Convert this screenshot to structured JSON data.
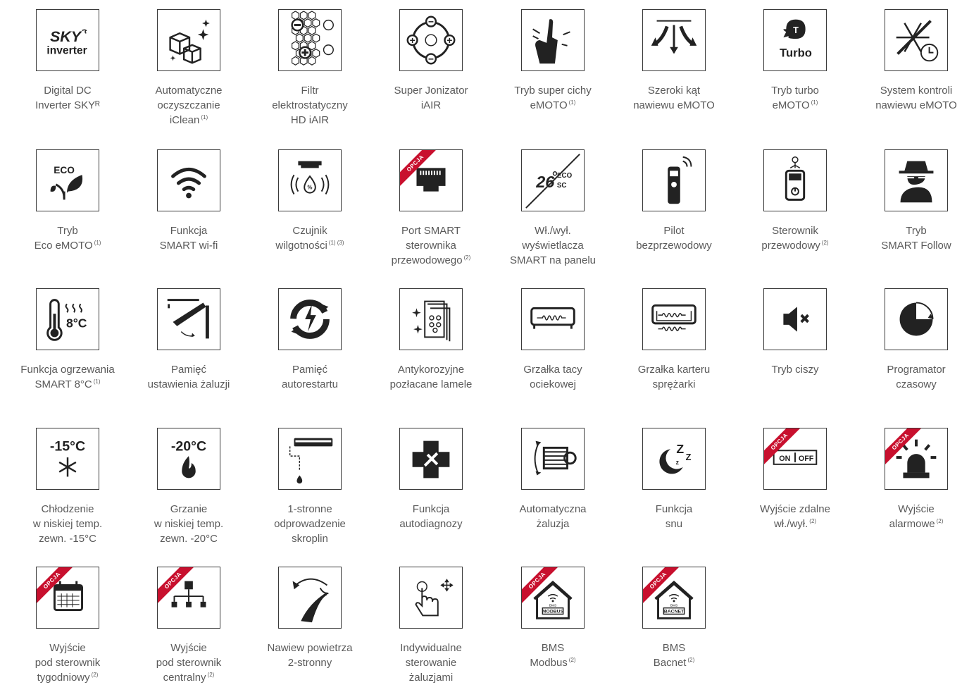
{
  "colors": {
    "border": "#3a3a3a",
    "icon": "#222222",
    "text": "#5a5a5a",
    "ribbon": "#c8102e"
  },
  "ribbon_label": "OPCJA",
  "features": [
    {
      "name": "feature-digital-inverter",
      "icon": "sky-inverter-logo",
      "iconText": [
        "SKY",
        "inverter"
      ],
      "lines": [
        "Digital DC",
        "Inverter SKYᴿ"
      ],
      "sup": ""
    },
    {
      "name": "feature-iclean",
      "icon": "cubes-sparkle-icon",
      "lines": [
        "Automatyczne",
        "oczyszczanie",
        "iClean"
      ],
      "sup": "(1)"
    },
    {
      "name": "feature-hd-iair",
      "icon": "filter-hex-icon",
      "lines": [
        "Filtr",
        "elektrostatyczny",
        "HD iAIR"
      ],
      "sup": ""
    },
    {
      "name": "feature-super-ionizer",
      "icon": "ionizer-icon",
      "lines": [
        "Super Jonizator",
        "iAIR"
      ],
      "sup": ""
    },
    {
      "name": "feature-quiet-mode",
      "icon": "silence-hand-icon",
      "lines": [
        "Tryb super cichy",
        "eMOTO"
      ],
      "sup": "(1)"
    },
    {
      "name": "feature-wide-angle",
      "icon": "wide-airflow-icon",
      "lines": [
        "Szeroki kąt",
        "nawiewu eMOTO"
      ],
      "sup": ""
    },
    {
      "name": "feature-turbo",
      "icon": "turbo-icon",
      "iconText": [
        "T",
        "Turbo"
      ],
      "lines": [
        "Tryb turbo",
        "eMOTO"
      ],
      "sup": "(1)"
    },
    {
      "name": "feature-airflow-control",
      "icon": "snowflake-clock-icon",
      "lines": [
        "System kontroli",
        "nawiewu eMOTO"
      ],
      "sup": ""
    },
    {
      "name": "feature-eco",
      "icon": "eco-leaf-icon",
      "iconText": [
        "ECO"
      ],
      "lines": [
        "Tryb",
        "Eco eMOTO"
      ],
      "sup": "(1)"
    },
    {
      "name": "feature-wifi",
      "icon": "wifi-icon",
      "lines": [
        "Funkcja",
        "SMART wi-fi"
      ],
      "sup": ""
    },
    {
      "name": "feature-humidity",
      "icon": "humidity-sensor-icon",
      "iconText": [
        "%"
      ],
      "lines": [
        "Czujnik",
        "wilgotności"
      ],
      "sup": "(1) (3)"
    },
    {
      "name": "feature-smart-port",
      "icon": "ethernet-port-icon",
      "option": true,
      "lines": [
        "Port SMART",
        "sterownika",
        "przewodowego"
      ],
      "sup": "(2)"
    },
    {
      "name": "feature-display-toggle",
      "icon": "display-off-icon",
      "iconText": [
        "26",
        "ECO",
        "SC"
      ],
      "lines": [
        "Wł./wył.",
        "wyświetlacza",
        "SMART na panelu"
      ],
      "sup": ""
    },
    {
      "name": "feature-remote",
      "icon": "remote-control-icon",
      "lines": [
        "Pilot",
        "bezprzewodowy"
      ],
      "sup": ""
    },
    {
      "name": "feature-wired-controller",
      "icon": "wired-controller-icon",
      "lines": [
        "Sterownik",
        "przewodowy"
      ],
      "sup": "(2)"
    },
    {
      "name": "feature-follow",
      "icon": "spy-icon",
      "lines": [
        "Tryb",
        "SMART Follow"
      ],
      "sup": ""
    },
    {
      "name": "feature-heating-8c",
      "icon": "thermometer-icon",
      "iconText": [
        "8°C"
      ],
      "lines": [
        "Funkcja ogrzewania",
        "SMART 8°C"
      ],
      "sup": "(1)"
    },
    {
      "name": "feature-louver-memory",
      "icon": "louver-memory-icon",
      "lines": [
        "Pamięć",
        "ustawienia żaluzji"
      ],
      "sup": ""
    },
    {
      "name": "feature-autorestart",
      "icon": "restart-icon",
      "lines": [
        "Pamięć",
        "autorestartu"
      ],
      "sup": ""
    },
    {
      "name": "feature-gold-fins",
      "icon": "gold-fins-icon",
      "lines": [
        "Antykorozyjne",
        "pozłacane lamele"
      ],
      "sup": ""
    },
    {
      "name": "feature-tray-heater",
      "icon": "tray-heater-icon",
      "lines": [
        "Grzałka tacy",
        "ociekowej"
      ],
      "sup": ""
    },
    {
      "name": "feature-crankcase-heater",
      "icon": "crankcase-heater-icon",
      "lines": [
        "Grzałka karteru",
        "sprężarki"
      ],
      "sup": ""
    },
    {
      "name": "feature-silent",
      "icon": "mute-icon",
      "lines": [
        "Tryb ciszy"
      ],
      "sup": ""
    },
    {
      "name": "feature-timer",
      "icon": "timer-icon",
      "lines": [
        "Programator",
        "czasowy"
      ],
      "sup": ""
    },
    {
      "name": "feature-cooling-low",
      "icon": "cooling-low-icon",
      "iconText": [
        "-15°C"
      ],
      "lines": [
        "Chłodzenie",
        "w niskiej temp.",
        "zewn. -15°C"
      ],
      "sup": ""
    },
    {
      "name": "feature-heating-low",
      "icon": "heating-low-icon",
      "iconText": [
        "-20°C"
      ],
      "lines": [
        "Grzanie",
        "w niskiej temp.",
        "zewn. -20°C"
      ],
      "sup": ""
    },
    {
      "name": "feature-condensate",
      "icon": "condensate-icon",
      "lines": [
        "1-stronne",
        "odprowadzenie",
        "skroplin"
      ],
      "sup": ""
    },
    {
      "name": "feature-diagnostics",
      "icon": "diagnostics-icon",
      "lines": [
        "Funkcja",
        "autodiagnozy"
      ],
      "sup": ""
    },
    {
      "name": "feature-auto-louver",
      "icon": "auto-louver-icon",
      "lines": [
        "Automatyczna",
        "żaluzja"
      ],
      "sup": ""
    },
    {
      "name": "feature-sleep",
      "icon": "sleep-icon",
      "lines": [
        "Funkcja",
        "snu"
      ],
      "sup": ""
    },
    {
      "name": "feature-remote-onoff",
      "icon": "on-off-icon",
      "option": true,
      "iconText": [
        "ON",
        "OFF"
      ],
      "lines": [
        "Wyjście zdalne",
        "wł./wył."
      ],
      "sup": "(2)"
    },
    {
      "name": "feature-alarm",
      "icon": "alarm-icon",
      "option": true,
      "lines": [
        "Wyjście",
        "alarmowe"
      ],
      "sup": "(2)"
    },
    {
      "name": "feature-weekly",
      "icon": "calendar-icon",
      "option": true,
      "lines": [
        "Wyjście",
        "pod sterownik",
        "tygodniowy"
      ],
      "sup": "(2)"
    },
    {
      "name": "feature-central",
      "icon": "network-icon",
      "option": true,
      "lines": [
        "Wyjście",
        "pod sterownik",
        "centralny"
      ],
      "sup": "(2)"
    },
    {
      "name": "feature-two-way",
      "icon": "two-way-airflow-icon",
      "lines": [
        "Nawiew powietrza",
        "2-stronny"
      ],
      "sup": ""
    },
    {
      "name": "feature-individual-louver",
      "icon": "touch-icon",
      "lines": [
        "Indywidualne",
        "sterowanie",
        "żaluzjami"
      ],
      "sup": ""
    },
    {
      "name": "feature-bms-modbus",
      "icon": "bms-house-icon",
      "option": true,
      "iconText": [
        "BMS",
        "MODBUS"
      ],
      "lines": [
        "BMS",
        "Modbus"
      ],
      "sup": "(2)"
    },
    {
      "name": "feature-bms-bacnet",
      "icon": "bms-house-icon",
      "option": true,
      "iconText": [
        "BMS",
        "BACNET"
      ],
      "lines": [
        "BMS",
        "Bacnet"
      ],
      "sup": "(2)"
    }
  ]
}
